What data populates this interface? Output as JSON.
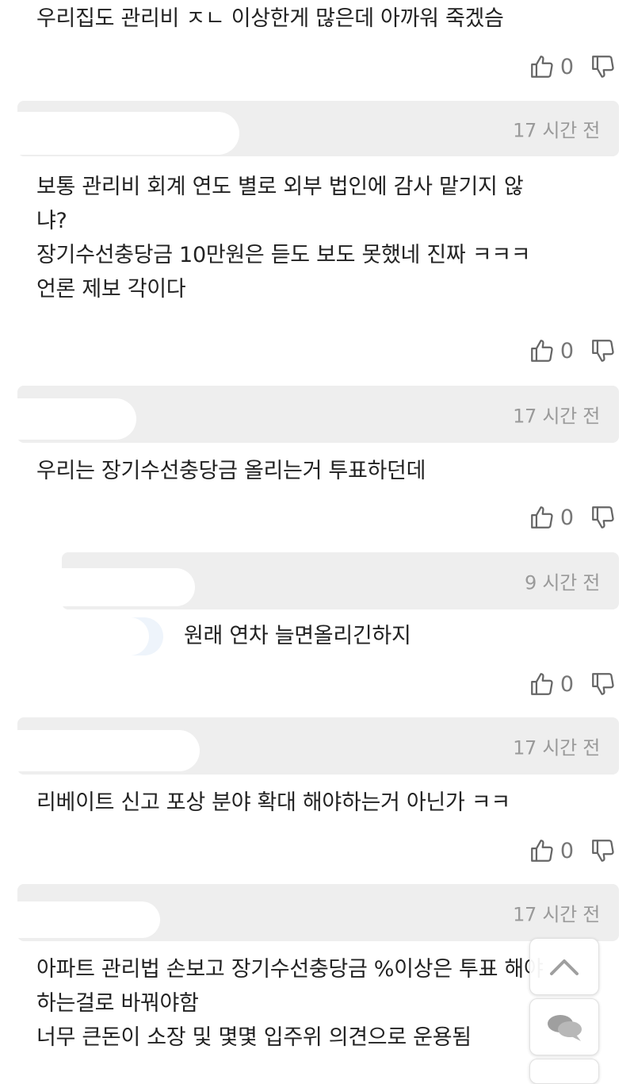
{
  "comments": [
    {
      "time": "",
      "lines": [
        "우리집도 관리비 ㅈㄴ 이상한게 많은데 아까워 죽겠슴"
      ],
      "likes": "0"
    },
    {
      "time": "17 시간 전",
      "lines": [
        "보통 관리비 회계 연도 별로 외부 법인에 감사 맡기지 않",
        "냐?",
        "장기수선충당금 10만원은 듣도 보도 못했네 진짜 ㅋㅋㅋ",
        "언론 제보 각이다"
      ],
      "likes": "0"
    },
    {
      "time": "17 시간 전",
      "lines": [
        "우리는 장기수선충당금 올리는거 투표하던데"
      ],
      "likes": "0"
    },
    {
      "time": "9 시간 전",
      "lines": [
        "원래 연차 늘면올리긴하지"
      ],
      "likes": "0"
    },
    {
      "time": "17 시간 전",
      "lines": [
        "리베이트 신고 포상 분야 확대 해야하는거 아닌가 ㅋㅋ"
      ],
      "likes": "0"
    },
    {
      "time": "17 시간 전",
      "lines": [
        "아파트 관리법 손보고 장기수선충당금 %이상은 투표 해야",
        "하는걸로 바꿔야함",
        "너무 큰돈이 소장 및 몇몇 입주위 의견으로 운용됨"
      ]
    }
  ],
  "icons": {
    "like": "thumbs-up-icon",
    "dislike": "thumbs-down-icon",
    "top": "chevron-up-icon",
    "chat": "chat-bubble-icon"
  },
  "colors": {
    "header_bg": "#eeeeee",
    "time": "#9a9a9a",
    "text": "#222222",
    "count": "#777777"
  }
}
